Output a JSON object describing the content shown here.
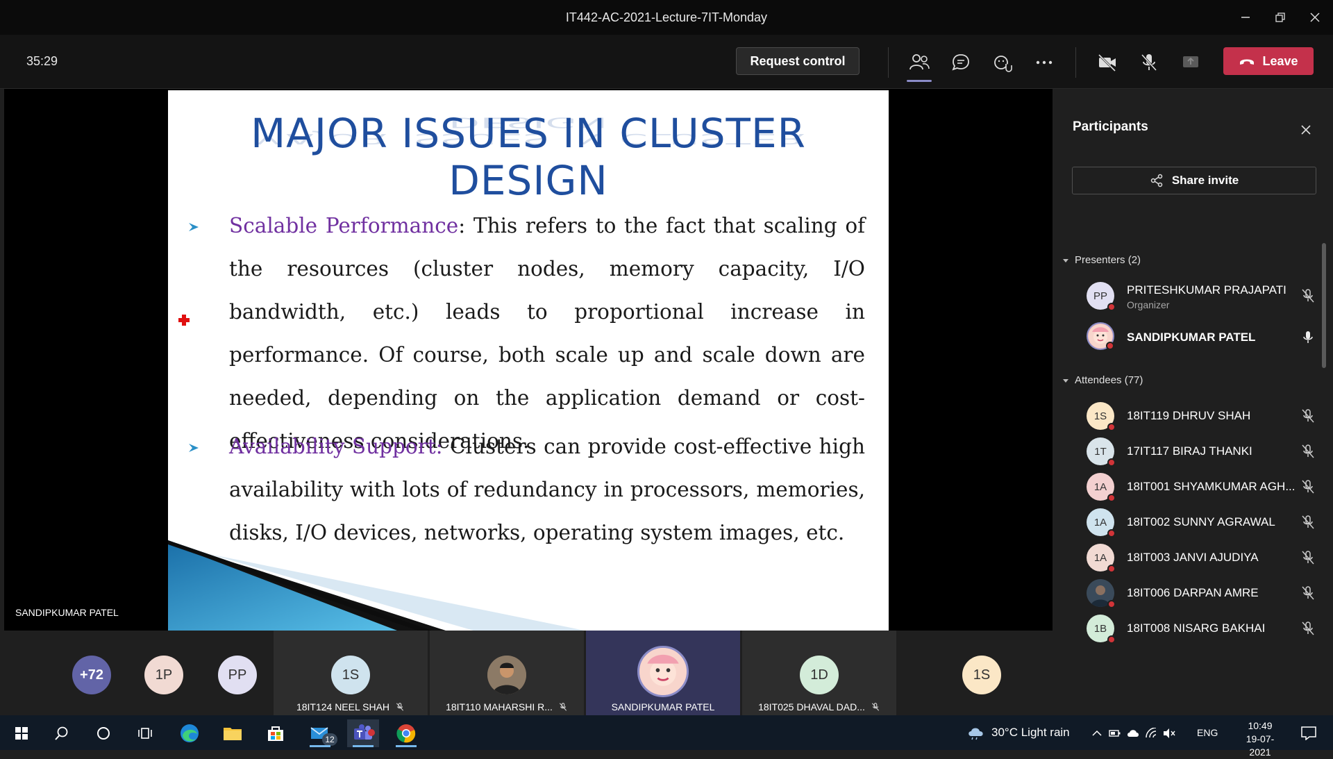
{
  "window": {
    "title": "IT442-AC-2021-Lecture-7IT-Monday"
  },
  "toolbar": {
    "timer": "35:29",
    "request_control": "Request control",
    "leave": "Leave"
  },
  "slide": {
    "title": "MAJOR ISSUES IN CLUSTER DESIGN",
    "bullets": [
      {
        "term": "Scalable Performance",
        "sep": ":",
        "text": " This refers to the fact that scaling of the resources (cluster nodes, memory capacity, I/O bandwidth, etc.) leads to proportional increase in performance. Of course, both scale up and scale down are needed, depending on the application demand or cost-effectiveness considerations."
      },
      {
        "term": "Availability Support:",
        "sep": "",
        "text": " Clusters can provide cost-effective high availability with lots of redundancy in processors, memories, disks, I/O devices, networks, operating system images, etc."
      }
    ]
  },
  "stage": {
    "speaker": "SANDIPKUMAR PATEL"
  },
  "panel": {
    "title": "Participants",
    "share_invite": "Share invite",
    "presenters_label": "Presenters (2)",
    "attendees_label": "Attendees (77)",
    "presenters": [
      {
        "initials": "PP",
        "name": "PRITESHKUMAR PRAJAPATI",
        "role": "Organizer",
        "color": "#e1dff2"
      },
      {
        "initials": "",
        "name": "SANDIPKUMAR PATEL",
        "role": "",
        "color": "#f6c7c0"
      }
    ],
    "attendees": [
      {
        "initials": "1S",
        "name": "18IT119 DHRUV SHAH",
        "color": "#fbe7c6"
      },
      {
        "initials": "1T",
        "name": "17IT117 BIRAJ THANKI",
        "color": "#d9e4ea"
      },
      {
        "initials": "1A",
        "name": "18IT001 SHYAMKUMAR AGH...",
        "color": "#f3d0d0"
      },
      {
        "initials": "1A",
        "name": "18IT002 SUNNY AGRAWAL",
        "color": "#cfe3ee"
      },
      {
        "initials": "1A",
        "name": "18IT003 JANVI AJUDIYA",
        "color": "#f1dad3"
      },
      {
        "initials": "",
        "name": "18IT006 DARPAN AMRE",
        "color": "#3a4a5a"
      },
      {
        "initials": "1B",
        "name": "18IT008 NISARG BAKHAI",
        "color": "#d3ecd9"
      }
    ]
  },
  "gallery": {
    "overflow": "+72",
    "tiles": [
      {
        "initials": "1P",
        "name": "",
        "color": "#f1dad3"
      },
      {
        "initials": "PP",
        "name": "",
        "color": "#e1dff2"
      },
      {
        "initials": "1S",
        "name": "18IT124 NEEL SHAH",
        "color": "#cfe3ee"
      },
      {
        "initials": "",
        "name": "18IT110 MAHARSHI R...",
        "color": "#6b5a4a"
      },
      {
        "initials": "",
        "name": "SANDIPKUMAR PATEL",
        "color": "#f6c7c0"
      },
      {
        "initials": "1D",
        "name": "18IT025 DHAVAL DAD...",
        "color": "#d3ecd9"
      },
      {
        "initials": "1S",
        "name": "",
        "color": "#fbe7c6"
      }
    ]
  },
  "taskbar": {
    "weather": "30°C  Light rain",
    "mail_badge": "12",
    "lang": "ENG",
    "time": "10:49",
    "date": "19-07-2021"
  },
  "colors": {
    "accent": "#6264a7",
    "leave": "#c4314b",
    "slide_title": "#1f4e9e",
    "slide_term": "#7030a0"
  }
}
